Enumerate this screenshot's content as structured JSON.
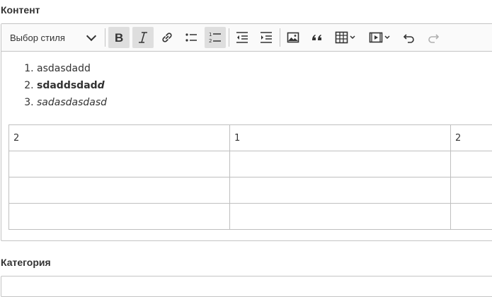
{
  "labels": {
    "content": "Контент",
    "category": "Категория"
  },
  "toolbar": {
    "style_dropdown": "Выбор стиля",
    "buttons": [
      "bold",
      "italic",
      "link",
      "bulleted-list",
      "numbered-list",
      "outdent",
      "indent",
      "image",
      "blockquote",
      "table",
      "media",
      "undo",
      "redo"
    ],
    "active": [
      "bold",
      "italic",
      "numbered-list"
    ]
  },
  "editor": {
    "list": {
      "item1": "asdasdadd",
      "item2_bold": "sdaddsdad",
      "item2_bold_italic": "d",
      "item3_italic": "sadasdasdasd"
    },
    "table": {
      "rows": [
        [
          "2",
          "1",
          "2"
        ],
        [
          "",
          "",
          ""
        ],
        [
          "",
          "",
          ""
        ],
        [
          "",
          "",
          ""
        ]
      ]
    }
  },
  "colors": {
    "border": "#c4c4c4",
    "toolbar_bg": "#fafafa",
    "active_btn": "#dedede",
    "redo_disabled": "#b0b0b0"
  }
}
